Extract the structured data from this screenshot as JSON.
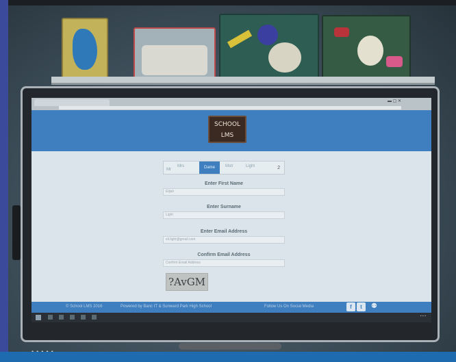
{
  "logo": {
    "line1": "SCHOOL",
    "line2": "LMS"
  },
  "titles": {
    "options": [
      "Mr",
      "Mrs",
      "Dame",
      "Mstr",
      "Light"
    ],
    "selected": "Dame",
    "count": "2"
  },
  "form": {
    "first_name": {
      "label": "Enter First Name",
      "value": "Elijah"
    },
    "surname": {
      "label": "Enter Surname",
      "value": "Light"
    },
    "email": {
      "label": "Enter Email Address",
      "value": "eli.light@gmail.com"
    },
    "confirm_email": {
      "label": "Confirm Email Address",
      "placeholder": "Confirm Email Address"
    },
    "captcha_text": "?AvGM"
  },
  "footer": {
    "copyright": "© School LMS 2016",
    "powered": "Powered by Banc IT & Sunward Park High School",
    "follow": "Follow Us On Social Media",
    "icons": [
      "facebook-icon",
      "twitter-icon",
      "people-icon"
    ]
  },
  "colors": {
    "brand_blue": "#3f7fc0",
    "title_selected": "#3f7fc0"
  }
}
